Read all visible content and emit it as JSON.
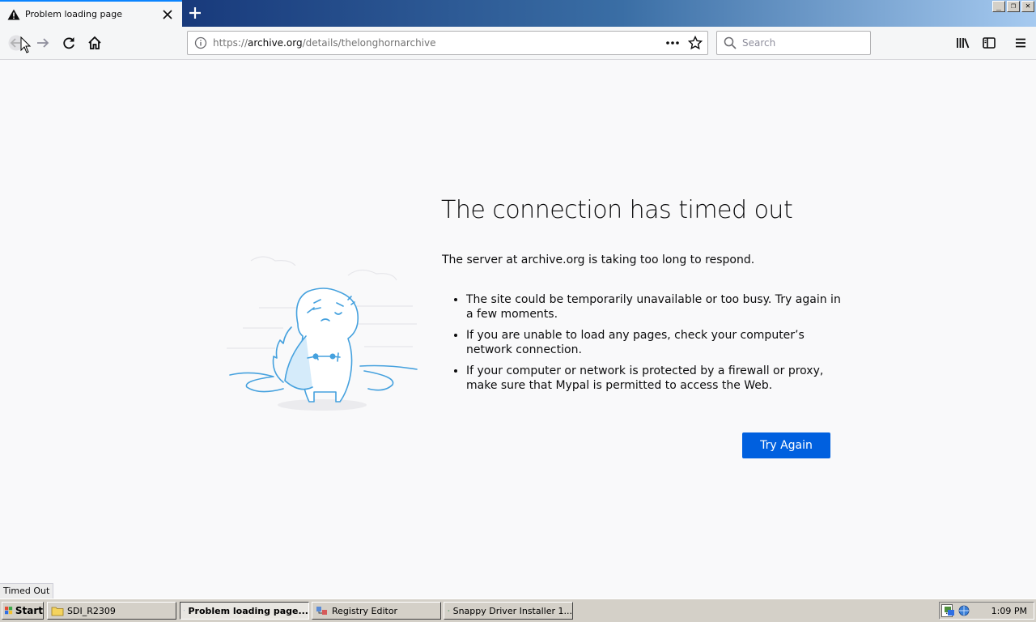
{
  "tab": {
    "title": "Problem loading page"
  },
  "window_buttons": {
    "minimize": "_",
    "restore": "❐",
    "close": "✕"
  },
  "urlbar": {
    "url_prefix": "https://",
    "url_host": "archive.org",
    "url_path": "/details/thelonghornarchive"
  },
  "search": {
    "placeholder": "Search"
  },
  "error": {
    "title": "The connection has timed out",
    "description": "The server at archive.org is taking too long to respond.",
    "bullets": [
      "The site could be temporarily unavailable or too busy. Try again in a few moments.",
      "If you are unable to load any pages, check your computer’s network connection.",
      "If your computer or network is protected by a firewall or proxy, make sure that Mypal is permitted to access the Web."
    ],
    "try_again_label": "Try Again"
  },
  "status_text": "Timed Out",
  "taskbar": {
    "start_label": "Start",
    "tasks": [
      {
        "label": "SDI_R2309",
        "icon": "folder-icon"
      },
      {
        "label": "Problem loading page...",
        "icon": "browser-icon",
        "active": true
      },
      {
        "label": "Registry Editor",
        "icon": "registry-icon"
      },
      {
        "label": "Snappy Driver Installer 1...",
        "icon": "snappy-icon"
      }
    ],
    "clock": "1:09 PM"
  },
  "colors": {
    "accent": "#0060df",
    "illustration_stroke": "#45a1de",
    "tab_highlight": "#0a84ff"
  }
}
